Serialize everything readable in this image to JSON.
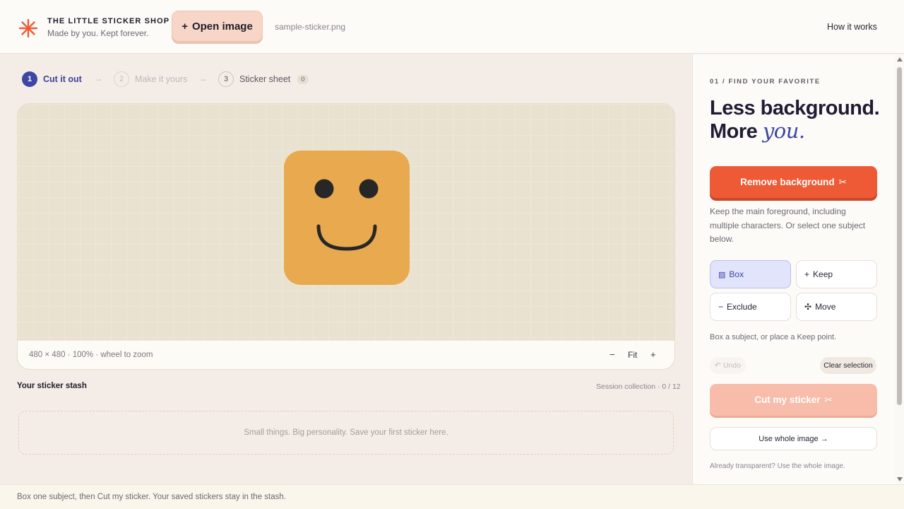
{
  "header": {
    "brand_title": "THE LITTLE STICKER SHOP",
    "brand_subtitle": "Made by you. Kept forever.",
    "open_image_label": "Open image",
    "filename": "sample-sticker.png",
    "how_it_works": "How it works"
  },
  "steps": [
    {
      "num": "1",
      "label": "Cut it out"
    },
    {
      "num": "2",
      "label": "Make it yours"
    },
    {
      "num": "3",
      "label": "Sticker sheet",
      "badge": "0"
    }
  ],
  "canvas": {
    "zoom_info": "480 × 480 · 100% · wheel to zoom",
    "zoom_out": "−",
    "fit": "Fit",
    "zoom_in": "+"
  },
  "stash": {
    "title": "Your sticker stash",
    "meta": "Session collection · 0 / 12",
    "empty_text": "Small things. Big personality. Save your first sticker here."
  },
  "status_bar": "Box one subject, then Cut my sticker. Your saved stickers stay in the stash.",
  "panel": {
    "eyebrow": "01 / FIND YOUR FAVORITE",
    "headline_line1": "Less background.",
    "headline_more": "More",
    "headline_you": "you.",
    "remove_bg_label": "Remove background",
    "remove_desc": "Keep the main foreground, including multiple characters. Or select one subject below.",
    "tools": {
      "box": "Box",
      "keep": "Keep",
      "exclude": "Exclude",
      "move": "Move"
    },
    "hint": "Box a subject, or place a Keep point.",
    "undo": "Undo",
    "clear_selection": "Clear selection",
    "cut_label": "Cut my sticker",
    "use_whole": "Use whole image →",
    "note": "Already transparent? Use the whole image."
  },
  "colors": {
    "accent_blue": "#3d46a5",
    "primary_orange": "#ee5a36",
    "sticker_fill": "#e8a94f"
  }
}
